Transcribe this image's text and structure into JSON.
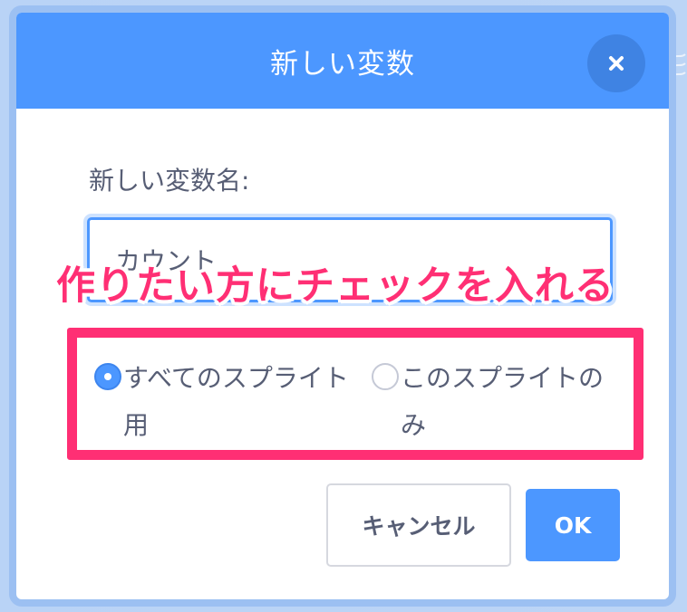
{
  "dialog": {
    "title": "新しい変数",
    "close_icon": "close-icon"
  },
  "form": {
    "name_label": "新しい変数名:",
    "name_value": "カウント"
  },
  "annotation": {
    "text": "作りたい方にチェックを入れる",
    "color": "#ff2f74"
  },
  "scope_options": [
    {
      "label": "すべてのスプライト用",
      "selected": true
    },
    {
      "label": "このスプライトのみ",
      "selected": false
    }
  ],
  "buttons": {
    "cancel": "キャンセル",
    "ok": "OK"
  },
  "colors": {
    "header": "#4c97ff",
    "close_button": "#3f83e3",
    "text": "#575e75",
    "highlight": "#ff2f74"
  }
}
